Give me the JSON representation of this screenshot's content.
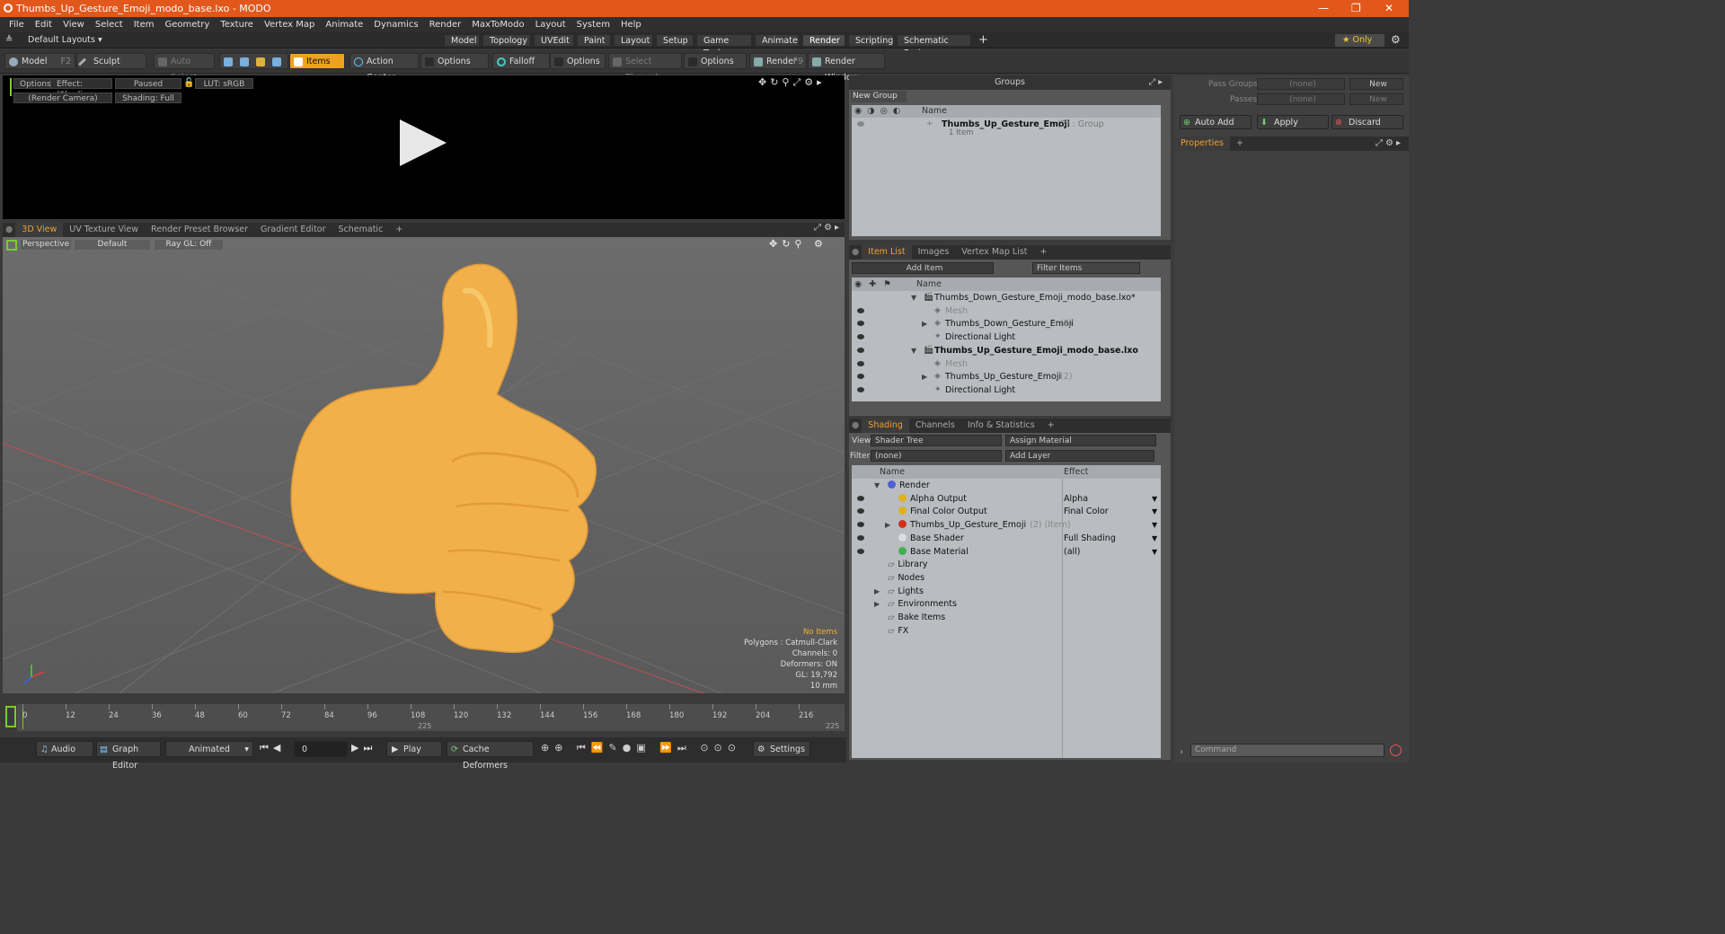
{
  "window": {
    "title": "Thumbs_Up_Gesture_Emoji_modo_base.lxo - MODO",
    "minimize": "—",
    "maximize": "❐",
    "close": "✕"
  },
  "menu": [
    "File",
    "Edit",
    "View",
    "Select",
    "Item",
    "Geometry",
    "Texture",
    "Vertex Map",
    "Animate",
    "Dynamics",
    "Render",
    "MaxToModo",
    "Layout",
    "System",
    "Help"
  ],
  "layouts": {
    "selector": "Default Layouts ▾",
    "tabs": [
      "Model",
      "Topology",
      "UVEdit",
      "Paint",
      "Layout",
      "Setup",
      "Game Tools",
      "Animate",
      "Render",
      "Scripting",
      "Schematic Fusion"
    ],
    "active": "Render",
    "add": "+",
    "only": "★  Only"
  },
  "toolbar": {
    "model": "Model",
    "model_key": "F2",
    "sculpt": "Sculpt",
    "auto_select": "Auto Select",
    "items": "Items",
    "action_center": "Action Center",
    "options1": "Options",
    "falloff": "Falloff",
    "options2": "Options",
    "select_through": "Select Through",
    "options3": "Options",
    "render": "Render",
    "render_key": "F9",
    "render_window": "Render Window"
  },
  "render_view": {
    "options": "Options",
    "effect": "Effect: (Shadi...",
    "paused": "Paused",
    "lut": "LUT: sRGB",
    "camera": "(Render Camera)",
    "shading": "Shading: Full"
  },
  "view_tabs": [
    "3D View",
    "UV Texture View",
    "Render Preset Browser",
    "Gradient Editor",
    "Schematic"
  ],
  "viewport": {
    "perspective": "Perspective",
    "default": "Default",
    "raygl": "Ray GL: Off",
    "hud": [
      "No Items",
      "Polygons : Catmull-Clark",
      "Channels: 0",
      "Deformers: ON",
      "GL: 19,792",
      "10 mm"
    ]
  },
  "timeline": {
    "ticks": [
      "0",
      "12",
      "24",
      "36",
      "48",
      "60",
      "72",
      "84",
      "96",
      "108",
      "120",
      "132",
      "144",
      "156",
      "168",
      "180",
      "192",
      "204",
      "216"
    ],
    "sub_mid": "225",
    "sub_end": "225"
  },
  "bottom": {
    "audio": "Audio",
    "graph_editor": "Graph Editor",
    "animated": "Animated",
    "frame": "0",
    "play": "Play",
    "cache": "Cache Deformers",
    "settings": "Settings"
  },
  "groups": {
    "title": "Groups",
    "new_group": "New Group",
    "col_name": "Name",
    "group_name": "Thumbs_Up_Gesture_Emoji",
    "group_count": "(3)",
    "group_type": ": Group",
    "group_items": "1 Item"
  },
  "item_list": {
    "tabs": [
      "Item List",
      "Images",
      "Vertex Map List"
    ],
    "add_item": "Add Item",
    "filter": "Filter Items",
    "col_name": "Name",
    "rows": [
      {
        "label": "Thumbs_Down_Gesture_Emoji_modo_base.lxo*",
        "indent": 0,
        "bold": false,
        "dim": false,
        "suffix": ""
      },
      {
        "label": "Mesh",
        "indent": 2,
        "bold": false,
        "dim": true,
        "suffix": ""
      },
      {
        "label": "Thumbs_Down_Gesture_Emoji",
        "indent": 1,
        "bold": false,
        "dim": false,
        "suffix": "(2)"
      },
      {
        "label": "Directional Light",
        "indent": 2,
        "bold": false,
        "dim": false,
        "suffix": ""
      },
      {
        "label": "Thumbs_Up_Gesture_Emoji_modo_base.lxo",
        "indent": 0,
        "bold": true,
        "dim": false,
        "suffix": ""
      },
      {
        "label": "Mesh",
        "indent": 2,
        "bold": false,
        "dim": true,
        "suffix": ""
      },
      {
        "label": "Thumbs_Up_Gesture_Emoji",
        "indent": 1,
        "bold": false,
        "dim": false,
        "suffix": "(2)"
      },
      {
        "label": "Directional Light",
        "indent": 2,
        "bold": false,
        "dim": false,
        "suffix": ""
      }
    ]
  },
  "shading": {
    "tabs": [
      "Shading",
      "Channels",
      "Info & Statistics"
    ],
    "view_label": "View",
    "view_value": "Shader Tree",
    "assign": "Assign Material",
    "filter_label": "Filter",
    "filter_value": "(none)",
    "add_layer": "Add Layer",
    "col_name": "Name",
    "col_effect": "Effect",
    "rows": [
      {
        "label": "Render",
        "effect": "",
        "suffix": "",
        "color": "#5060d0"
      },
      {
        "label": "Alpha Output",
        "effect": "Alpha",
        "suffix": "",
        "color": "#e0b020"
      },
      {
        "label": "Final Color Output",
        "effect": "Final Color",
        "suffix": "",
        "color": "#e0b020"
      },
      {
        "label": "Thumbs_Up_Gesture_Emoji",
        "effect": "",
        "suffix": "(2) (Item)",
        "color": "#d03020"
      },
      {
        "label": "Base Shader",
        "effect": "Full Shading",
        "suffix": "",
        "color": "#dddddd"
      },
      {
        "label": "Base Material",
        "effect": "(all)",
        "suffix": "",
        "color": "#40b050"
      },
      {
        "label": "Library",
        "effect": "",
        "suffix": "",
        "color": ""
      },
      {
        "label": "Nodes",
        "effect": "",
        "suffix": "",
        "color": ""
      },
      {
        "label": "Lights",
        "effect": "",
        "suffix": "",
        "color": ""
      },
      {
        "label": "Environments",
        "effect": "",
        "suffix": "",
        "color": ""
      },
      {
        "label": "Bake Items",
        "effect": "",
        "suffix": "",
        "color": ""
      },
      {
        "label": "FX",
        "effect": "",
        "suffix": "",
        "color": ""
      }
    ]
  },
  "pass": {
    "pass_groups": "Pass Groups",
    "passes": "Passes",
    "none": "(none)",
    "new": "New",
    "auto_add": "Auto Add",
    "apply": "Apply",
    "discard": "Discard",
    "properties": "Properties",
    "command": "Command"
  }
}
